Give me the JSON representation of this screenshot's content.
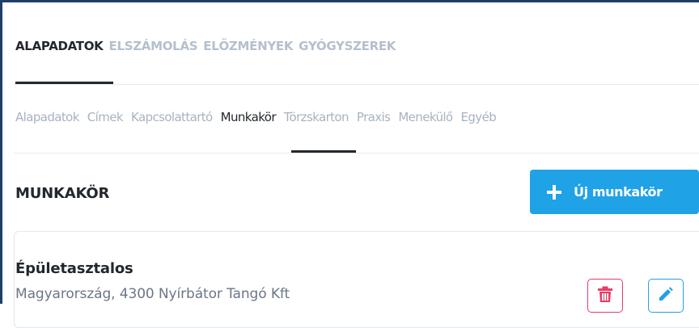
{
  "primary_tabs": [
    {
      "label": "ALAPADATOK",
      "active": true
    },
    {
      "label": "ELSZÁMOLÁS",
      "active": false
    },
    {
      "label": "ELŐZMÉNYEK",
      "active": false
    },
    {
      "label": "GYÓGYSZEREK",
      "active": false
    }
  ],
  "secondary_tabs": [
    {
      "label": "Alapadatok",
      "active": false
    },
    {
      "label": "Címek",
      "active": false
    },
    {
      "label": "Kapcsolattartó",
      "active": false
    },
    {
      "label": "Munkakör",
      "active": true
    },
    {
      "label": "Törzskarton",
      "active": false
    },
    {
      "label": "Praxis",
      "active": false
    },
    {
      "label": "Menekülő",
      "active": false
    },
    {
      "label": "Egyéb",
      "active": false
    }
  ],
  "section": {
    "title": "MUNKAKÖR",
    "new_button_label": "Új munkakör",
    "new_button_icon": "plus-icon"
  },
  "card": {
    "title": "Épületasztalos",
    "subtitle": "Magyarország, 4300 Nyírbátor Tangó Kft",
    "delete_icon": "trash-icon",
    "edit_icon": "pencil-icon"
  },
  "colors": {
    "primary": "#1fa2e6",
    "danger": "#e63c67",
    "text": "#23282d",
    "muted": "#b5c0cc",
    "border_accent": "#1d3f6a"
  }
}
